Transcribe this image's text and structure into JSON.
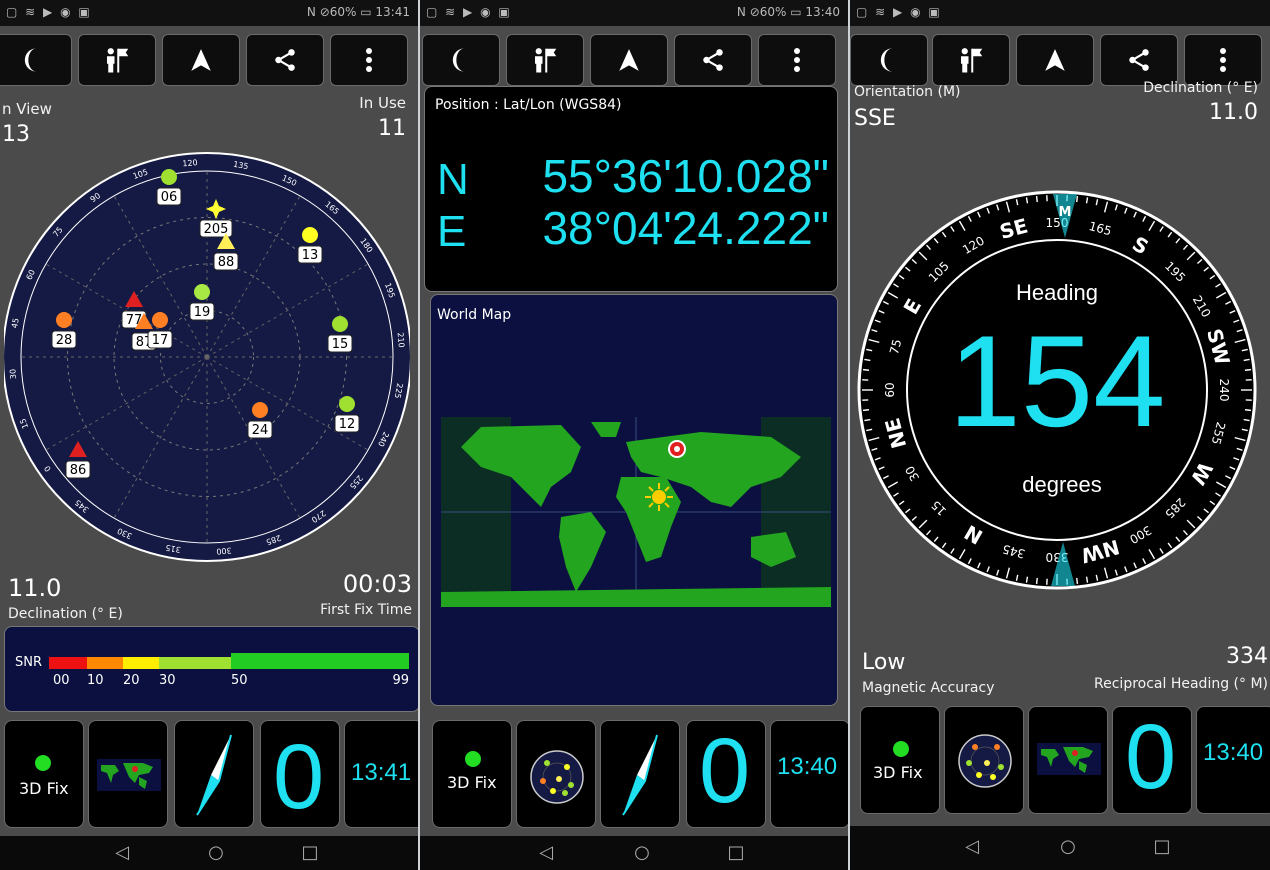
{
  "panel1": {
    "status": {
      "left": "▢ ≋ ▶ ◉ ▣",
      "right": "N ⊘60% ▭ 13:41"
    },
    "in_view_label": "n View",
    "in_view_value": "13",
    "in_use_label": "In Use",
    "in_use_value": "11",
    "skyplot_ticks": [
      "135",
      "150",
      "165",
      "180",
      "195",
      "210",
      "225",
      "240",
      "255",
      "270",
      "285",
      "300",
      "315",
      "330",
      "345",
      "0",
      "15",
      "30",
      "45",
      "60",
      "75",
      "90",
      "105",
      "120"
    ],
    "satellites": [
      {
        "id": "06",
        "color": "#9fe030",
        "shape": "circle"
      },
      {
        "id": "205",
        "color": "#ffff33",
        "shape": "star"
      },
      {
        "id": "88",
        "color": "#ffee55",
        "shape": "triangle"
      },
      {
        "id": "13",
        "color": "#ffff22",
        "shape": "circle"
      },
      {
        "id": "19",
        "color": "#a8e845",
        "shape": "circle"
      },
      {
        "id": "77",
        "color": "#e02020",
        "shape": "triangle"
      },
      {
        "id": "87",
        "color": "#ff7f22",
        "shape": "triangle"
      },
      {
        "id": "17",
        "color": "#ff7f22",
        "shape": "circle"
      },
      {
        "id": "28",
        "color": "#ff7f22",
        "shape": "circle"
      },
      {
        "id": "15",
        "color": "#9fe030",
        "shape": "circle"
      },
      {
        "id": "24",
        "color": "#ff7f22",
        "shape": "circle"
      },
      {
        "id": "12",
        "color": "#9fe030",
        "shape": "circle"
      },
      {
        "id": "86",
        "color": "#e02020",
        "shape": "triangle"
      }
    ],
    "declination_value": "11.0",
    "declination_label": "Declination (° E)",
    "first_fix_value": "00:03",
    "first_fix_label": "First Fix Time",
    "snr_label": "SNR",
    "snr_ticks": [
      "00",
      "10",
      "20",
      "30",
      "50",
      "99"
    ],
    "tiles": {
      "fix_label": "3D Fix",
      "zero": "0",
      "clock": "13:41"
    }
  },
  "panel2": {
    "status": {
      "left": "▢ ≋ ▶ ◉ ▣",
      "right": "N ⊘60% ▭ 13:40"
    },
    "position_title": "Position : Lat/Lon (WGS84)",
    "lat_hemi": "N",
    "lat_value": "55°36'10.028\"",
    "lon_hemi": "E",
    "lon_value": "38°04'24.222\"",
    "world_map_title": "World Map",
    "tiles": {
      "fix_label": "3D Fix",
      "zero": "0",
      "clock": "13:40"
    }
  },
  "panel3": {
    "status": {
      "left": "▢ ≋ ▶ ◉ ▣",
      "right": ""
    },
    "orientation_label": "Orientation (M)",
    "orientation_value": "SSE",
    "declination_label": "Declination (° E)",
    "declination_value": "11.0",
    "heading_label": "Heading",
    "heading_value": "154",
    "degrees_label": "degrees",
    "compass_marker": "M",
    "compass_labels": [
      "150",
      "165",
      "S",
      "195",
      "210",
      "SW",
      "240",
      "255",
      "W",
      "285",
      "300",
      "NW",
      "330",
      "345",
      "N",
      "15",
      "30",
      "NE",
      "60",
      "75",
      "E",
      "105",
      "120",
      "SE"
    ],
    "magnetic_accuracy_value": "Low",
    "magnetic_accuracy_label": "Magnetic Accuracy",
    "reciprocal_value": "334",
    "reciprocal_label": "Reciprocal Heading (° M)",
    "tiles": {
      "fix_label": "3D Fix",
      "zero": "0",
      "clock": "13:40"
    }
  },
  "colors": {
    "accent": "#1ee0f0",
    "sky_bg": "#151a44",
    "map_land": "#23a520",
    "map_sea": "#0b1040",
    "fix_dot": "#22dd22"
  }
}
